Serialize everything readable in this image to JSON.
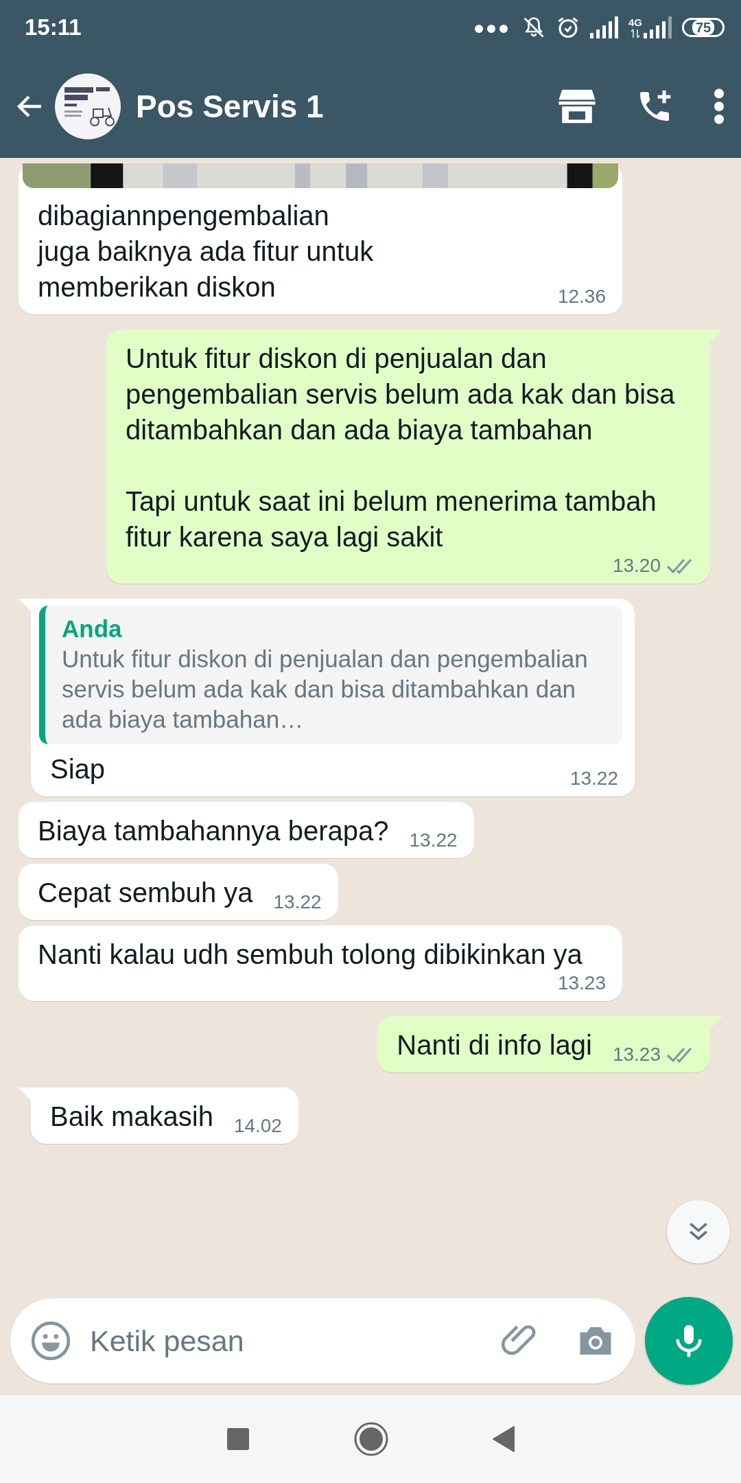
{
  "status_bar": {
    "time": "15:11",
    "network": "4G",
    "battery": "75"
  },
  "header": {
    "title": "Pos Servis 1"
  },
  "messages": [
    {
      "kind": "incoming",
      "text": "dibagiannpengembalian\njuga baiknya ada fitur untuk\nmemberikan diskon",
      "time": "12.36"
    },
    {
      "kind": "outgoing",
      "text": "Untuk fitur diskon di penjualan dan pengembalian servis belum ada kak dan bisa ditambahkan dan ada biaya tambahan\n\nTapi untuk saat ini belum menerima tambah fitur karena saya lagi sakit",
      "time": "13.20",
      "read": false
    },
    {
      "kind": "incoming",
      "quote": {
        "author": "Anda",
        "text": "Untuk fitur diskon di penjualan dan pengembalian servis belum ada kak dan bisa ditambahkan dan ada biaya tambahan…"
      },
      "text": "Siap",
      "time": "13.22"
    },
    {
      "kind": "incoming",
      "text": "Biaya tambahannya berapa?",
      "time": "13.22"
    },
    {
      "kind": "incoming",
      "text": "Cepat sembuh ya",
      "time": "13.22"
    },
    {
      "kind": "incoming",
      "text": "Nanti kalau udh sembuh tolong dibikinkan ya",
      "time": "13.23"
    },
    {
      "kind": "outgoing",
      "text": "Nanti di info lagi",
      "time": "13.23",
      "read": false
    },
    {
      "kind": "incoming",
      "text": "Baik makasih",
      "time": "14.02"
    }
  ],
  "composer": {
    "placeholder": "Ketik pesan"
  }
}
